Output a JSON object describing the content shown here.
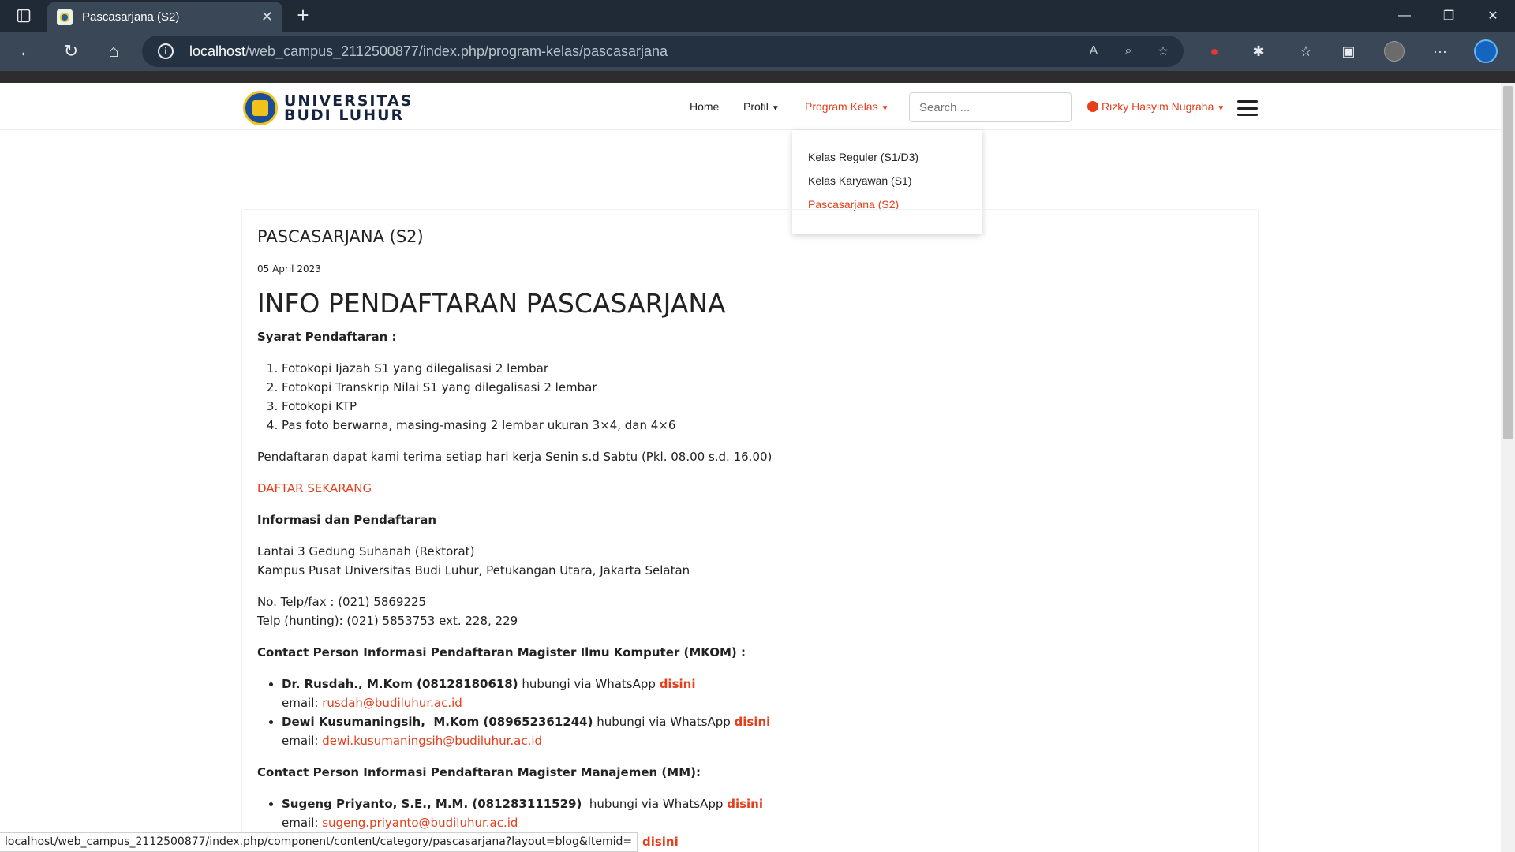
{
  "browser": {
    "tab_title": "Pascasarjana (S2)",
    "url_host": "localhost",
    "url_path": "/web_campus_2112500877/index.php/program-kelas/pascasarjana",
    "status_url": "localhost/web_campus_2112500877/index.php/component/content/category/pascasarjana?layout=blog&Itemid="
  },
  "site": {
    "logo_line1": "UNIVERSITAS",
    "logo_line2": "BUDI LUHUR",
    "nav": {
      "home": "Home",
      "profil": "Profil",
      "program_kelas": "Program Kelas"
    },
    "search_placeholder": "Search ...",
    "user_name": "Rizky Hasyim Nugraha",
    "dropdown": [
      "Kelas Reguler (S1/D3)",
      "Kelas Karyawan (S1)",
      "Pascasarjana (S2)"
    ],
    "accent_color": "#e63e1a"
  },
  "article": {
    "page_title": "PASCASARJANA (S2)",
    "date": "05 April 2023",
    "heading": "INFO PENDAFTARAN PASCASARJANA",
    "syarat_label": "Syarat Pendaftaran :",
    "syarat": [
      "Fotokopi Ijazah S1 yang dilegalisasi 2 lembar",
      "Fotokopi Transkrip Nilai S1 yang dilegalisasi 2 lembar",
      "Fotokopi KTP",
      "Pas foto berwarna, masing-masing 2 lembar ukuran 3×4, dan 4×6"
    ],
    "jadwal": "Pendaftaran dapat kami terima setiap hari kerja Senin s.d Sabtu (Pkl. 08.00 s.d. 16.00)",
    "daftar_link": "DAFTAR SEKARANG",
    "info_label": "Informasi dan Pendaftaran",
    "alamat1": "Lantai 3 Gedung Suhanah (Rektorat)",
    "alamat2": "Kampus Pusat Universitas Budi Luhur, Petukangan Utara, Jakarta Selatan",
    "telp1": "No. Telp/fax : (021) 5869225",
    "telp2": "Telp (hunting): (021) 5853753 ext. 228, 229",
    "mkom_label": "Contact Person Informasi Pendaftaran Magister Ilmu Komputer (MKOM) :",
    "mkom": [
      {
        "name": "Dr. Rusdah., M.Kom (08128180618)",
        "via": " hubungi via WhatsApp ",
        "link": "disini",
        "email_label": "email: ",
        "email": "rusdah@budiluhur.ac.id"
      },
      {
        "name": "Dewi Kusumaningsih,  M.Kom (089652361244)",
        "via": " hubungi via WhatsApp ",
        "link": "disini",
        "email_label": "email: ",
        "email": "dewi.kusumaningsih@budiluhur.ac.id"
      }
    ],
    "mm_label": "Contact Person Informasi Pendaftaran Magister Manajemen (MM):",
    "mm": [
      {
        "name": "Sugeng Priyanto, S.E., M.M. (081283111529)",
        "via": "  hubungi via WhatsApp ",
        "link": "disini",
        "email_label": "email: ",
        "email": "sugeng.priyanto@budiluhur.ac.id"
      }
    ],
    "mm_partial_via": "atsApp ",
    "mm_partial_link": "disini"
  }
}
